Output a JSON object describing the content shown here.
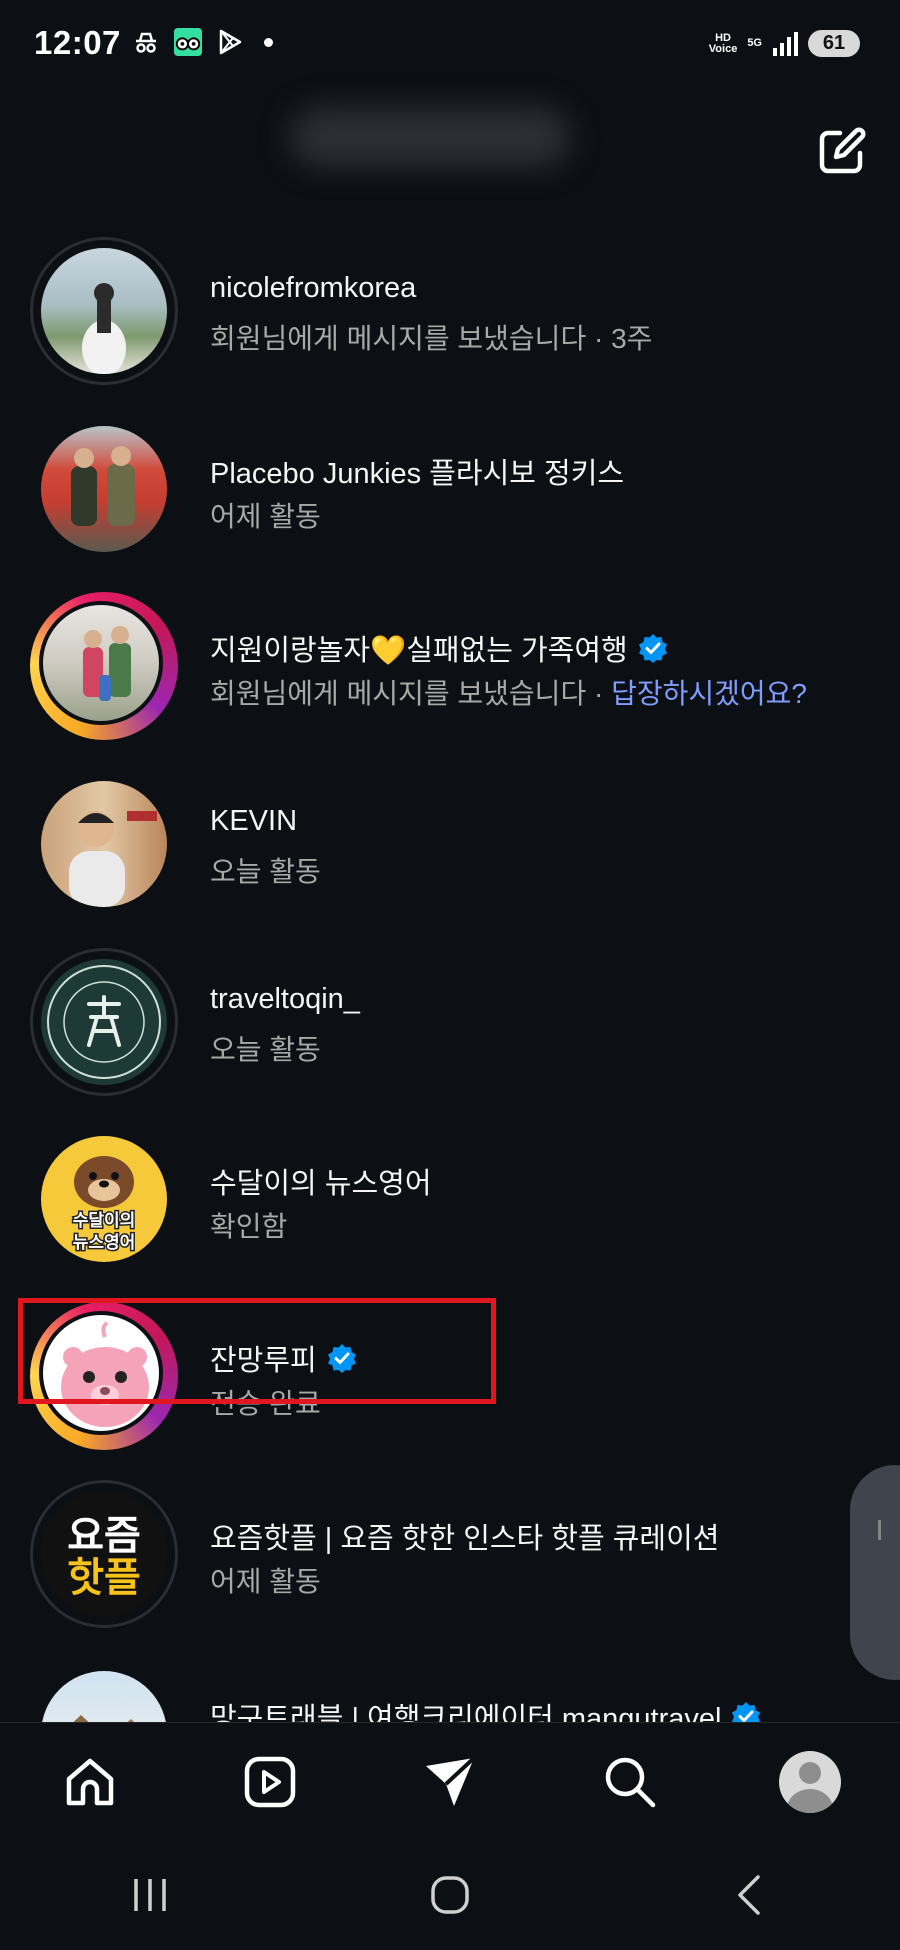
{
  "status_bar": {
    "time": "12:07",
    "hd_voice": "HD\nVoice",
    "network": "5G",
    "battery": "61"
  },
  "header": {
    "title": "username"
  },
  "threads": [
    {
      "name": "nicolefromkorea",
      "subtitle": "회원님에게 메시지를 보냈습니다 · 3주",
      "verified": false,
      "story": false
    },
    {
      "name": "Placebo Junkies   플라시보 정키스",
      "subtitle": "어제 활동",
      "verified": false,
      "story": false
    },
    {
      "name": "지원이랑놀자💛실패없는 가족여행",
      "subtitle": "회원님에게 메시지를 보냈습니다 · ",
      "subtitle_link": "답장하시겠어요?",
      "verified": true,
      "story": true
    },
    {
      "name": "KEVIN",
      "subtitle": "오늘 활동",
      "verified": false,
      "story": false
    },
    {
      "name": "traveltoqin_",
      "subtitle": "오늘 활동",
      "verified": false,
      "story": false
    },
    {
      "name": "수달이의 뉴스영어",
      "subtitle": "확인함",
      "verified": false,
      "story": false,
      "avatar_text": "수달이의\n뉴스영어"
    },
    {
      "name": "잔망루피",
      "subtitle": "전송 완료",
      "verified": true,
      "story": true
    },
    {
      "name": "요즘핫플 | 요즘 핫한 인스타 핫플 큐레이션",
      "subtitle": "어제 활동",
      "verified": false,
      "story": false,
      "avatar_text_top": "요즘",
      "avatar_text_bottom": "핫플"
    },
    {
      "name": "망구트래블 | 여행크리에이터 mangutravel",
      "subtitle": "",
      "verified": true,
      "story": false
    }
  ],
  "colors": {
    "background": "#0c1014",
    "link": "#7f9cff",
    "verified": "#0095f6",
    "highlight": "#e0171e"
  },
  "icons": {
    "compose": "edit-square-icon",
    "home": "home-icon",
    "reels": "reels-icon",
    "direct": "paper-plane-icon",
    "search": "search-icon",
    "profile": "profile-avatar"
  }
}
